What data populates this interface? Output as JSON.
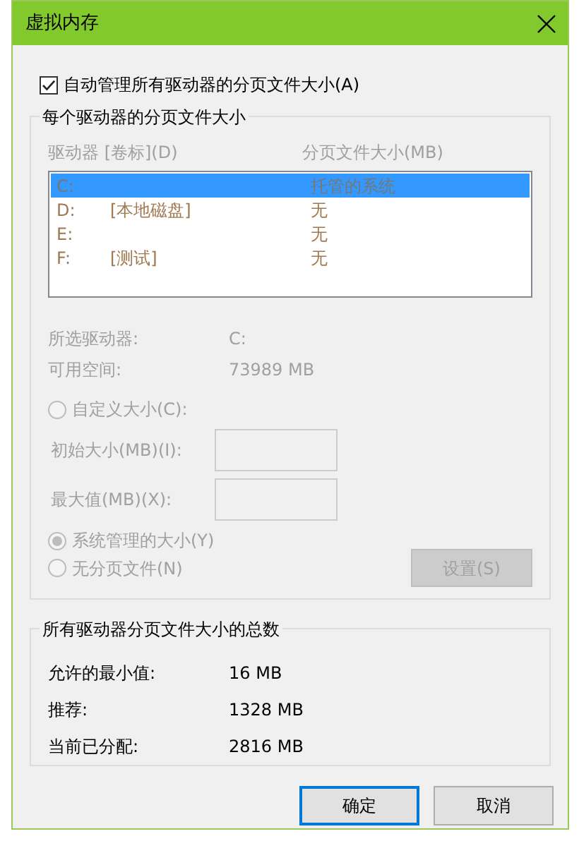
{
  "window": {
    "title": "虚拟内存"
  },
  "auto_manage": {
    "label": "自动管理所有驱动器的分页文件大小(A)",
    "checked": true
  },
  "per_drive": {
    "title": "每个驱动器的分页文件大小",
    "disabled": true,
    "columns": [
      "驱动器 [卷标](D)",
      "分页文件大小(MB)"
    ],
    "drives": [
      {
        "drive": "C:",
        "size": "托管的系统",
        "selected": true
      },
      {
        "drive": "D:",
        "label": "[本地磁盘]",
        "size": "无",
        "selected": false
      },
      {
        "drive": "E:",
        "size": "无",
        "selected": false
      },
      {
        "drive": "F:",
        "label": "[测试]",
        "size": "无",
        "selected": false
      }
    ],
    "info": [
      {
        "label": "所选驱动器:",
        "value": "C:"
      },
      {
        "label": "可用空间:",
        "value": "73989 MB"
      }
    ],
    "options": [
      {
        "label": "自定义大小(C):",
        "selected": false,
        "fields": [
          {
            "label": "初始大小(MB)(I):"
          },
          {
            "label": "最大值(MB)(X):"
          }
        ]
      },
      {
        "label": "系统管理的大小(Y)",
        "selected": true
      },
      {
        "label": "无分页文件(N)",
        "selected": false
      }
    ],
    "set_button": "设置(S)"
  },
  "totals": {
    "title": "所有驱动器分页文件大小的总数",
    "rows": [
      {
        "label": "允许的最小值:",
        "value": "16 MB"
      },
      {
        "label": "推荐:",
        "value": "1328 MB"
      },
      {
        "label": "当前已分配:",
        "value": "2816 MB"
      }
    ]
  },
  "buttons": [
    {
      "label": "确定",
      "default": true
    },
    {
      "label": "取消",
      "default": false
    }
  ]
}
